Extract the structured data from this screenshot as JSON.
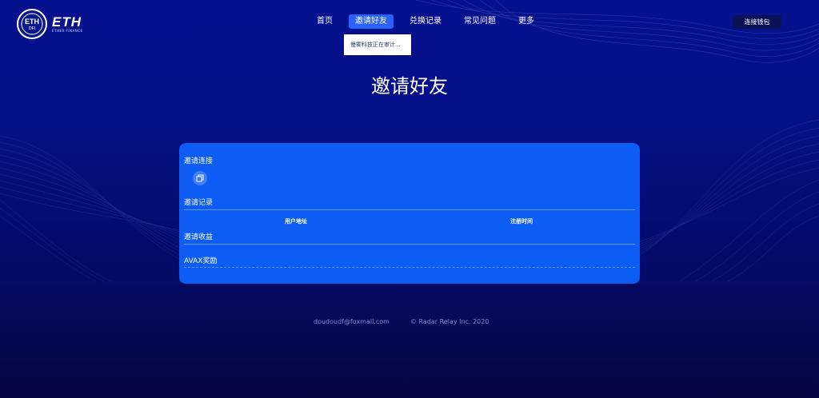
{
  "brand": {
    "badge_text": "ETH",
    "badge_sub": "DFI",
    "name": "ETH",
    "tagline": "ETHER FINANCE"
  },
  "nav": {
    "items": [
      {
        "label": "首页"
      },
      {
        "label": "邀请好友"
      },
      {
        "label": "兑换记录"
      },
      {
        "label": "常见问题"
      },
      {
        "label": "更多"
      }
    ],
    "active_index": 1,
    "dropdown_text": "慢雾科技正在审计..."
  },
  "connect_wallet_label": "连接钱包",
  "page_title": "邀请好友",
  "card": {
    "invite_link_label": "邀请连接",
    "invite_records_label": "邀请记录",
    "table_headers": [
      "用户地址",
      "注册时间"
    ],
    "invite_earnings_label": "邀请收益",
    "avax_reward_label": "AVAX奖励"
  },
  "footer": {
    "email": "doudoudf@foxmail.com",
    "copyright": "© Radar Relay Inc. 2020"
  },
  "colors": {
    "background": "#061086",
    "card": "#0d5cf3",
    "active_nav": "#2962ff",
    "button": "#0a1255"
  },
  "icons": [
    "copy-icon"
  ]
}
